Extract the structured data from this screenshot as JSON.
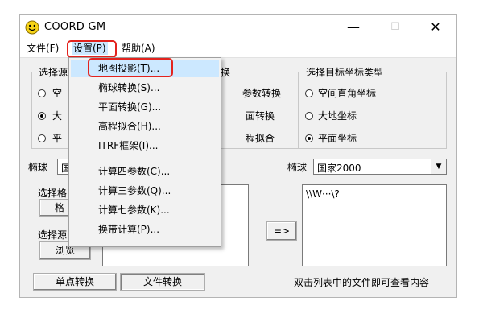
{
  "window": {
    "title": "COORD GM —",
    "controls": {
      "minimize": "—",
      "maximize": "☐",
      "close": "✕"
    }
  },
  "menubar": {
    "items": [
      "文件(F)",
      "设置(P)",
      "帮助(A)"
    ],
    "active": "设置(P)"
  },
  "settings_menu": {
    "items": [
      "地图投影(T)...",
      "椭球转换(S)...",
      "平面转换(G)...",
      "高程拟合(H)...",
      "ITRF框架(I)...",
      "计算四参数(C)...",
      "计算三参数(Q)...",
      "计算七参数(K)...",
      "换带计算(P)..."
    ],
    "highlighted": "地图投影(T)..."
  },
  "source_group": {
    "title_partial": "选择源",
    "options_partial": [
      "空",
      "大",
      "平"
    ],
    "selected_index": 1
  },
  "transform_group": {
    "title_partial": "换",
    "options_partial": [
      "参数转换",
      "面转换",
      "程拟合"
    ]
  },
  "target_group": {
    "title": "选择目标坐标类型",
    "options": [
      "空间直角坐标",
      "大地坐标",
      "平面坐标"
    ],
    "selected_index": 2
  },
  "left_ellipsoid": {
    "label": "椭球",
    "value_partial": "国"
  },
  "right_ellipsoid": {
    "label": "椭球",
    "value": "国家2000"
  },
  "left_panel": {
    "format_label_partial": "选择格",
    "format_button_partial": "格",
    "source_label_partial": "选择源",
    "browse_button": "浏览"
  },
  "arrow_button": "=>",
  "right_list": {
    "text": "\\\\W···\\?"
  },
  "bottom": {
    "single_point_button": "单点转换",
    "file_convert_button": "文件转换",
    "hint": "双击列表中的文件即可查看内容"
  },
  "colors": {
    "highlight": "#cce8ff",
    "annotation_red": "#e3231e",
    "smiley": "#f7d417"
  },
  "icons": {
    "app": "smiley-icon",
    "dropdown": "chevron-down-icon"
  }
}
